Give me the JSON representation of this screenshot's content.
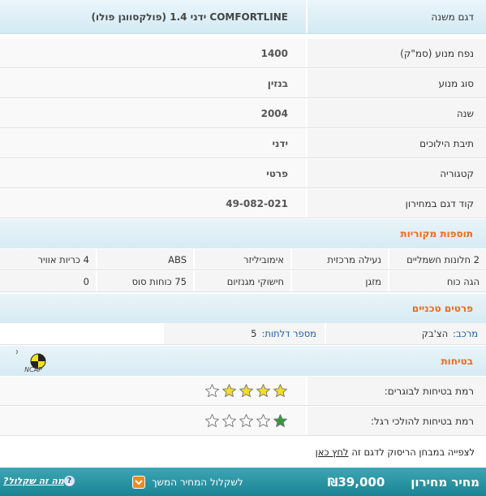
{
  "model_row": {
    "label": "דגם משנה",
    "value": "COMFORTLINE ידני 1.4 (פולקסווגן פולו)"
  },
  "specs": [
    {
      "label": "נפח מנוע (סמ\"ק)",
      "value": "1400"
    },
    {
      "label": "סוג מנוע",
      "value": "בנזין"
    },
    {
      "label": "שנה",
      "value": "2004"
    },
    {
      "label": "תיבת הילוכים",
      "value": "ידני"
    },
    {
      "label": "קטגוריה",
      "value": "פרטי"
    },
    {
      "label": "קוד דגם במחירון",
      "value": "49-082-021"
    }
  ],
  "extras": {
    "title": "תוספות מקוריות",
    "rows": [
      [
        "2 חלונות חשמליים",
        "נעילה מרכזית",
        "אימוביליזר",
        "ABS",
        "4 כריות אוויר"
      ],
      [
        "הגה כוח",
        "מזגן",
        "חישוקי מגנזיום",
        "75 כוחות סוס",
        "0"
      ]
    ]
  },
  "technical": {
    "title": "פרטים טכניים",
    "body_label": "מרכב:",
    "body_value": "הצ'בק",
    "doors_label": "מספר דלתות:",
    "doors_value": "5"
  },
  "safety": {
    "title": "בטיחות",
    "logo_text": "EURO NCAP",
    "adults_label": "רמת בטיחות לבוגרים:",
    "adults_stars": 4,
    "pedestrians_label": "רמת בטיחות להולכי רגל:",
    "pedestrians_stars": 1,
    "max_stars": 5,
    "crash_test_text": "לצפייה במבחן הריסוק לדגם זה",
    "crash_test_link": "לחץ כאן"
  },
  "price": {
    "label": "מחיר מחירון",
    "value": "39,000",
    "currency": "₪",
    "action_label": "לשקלול המחיר המשך",
    "whatis_label": "מה זה שקלול?",
    "help_glyph": "?"
  },
  "colors": {
    "accent_orange": "#ee6a1c",
    "bar_teal": "#1b8494",
    "star_yellow": "#f5dc2a",
    "star_green": "#2f9a3c",
    "star_empty": "#ffffff"
  }
}
